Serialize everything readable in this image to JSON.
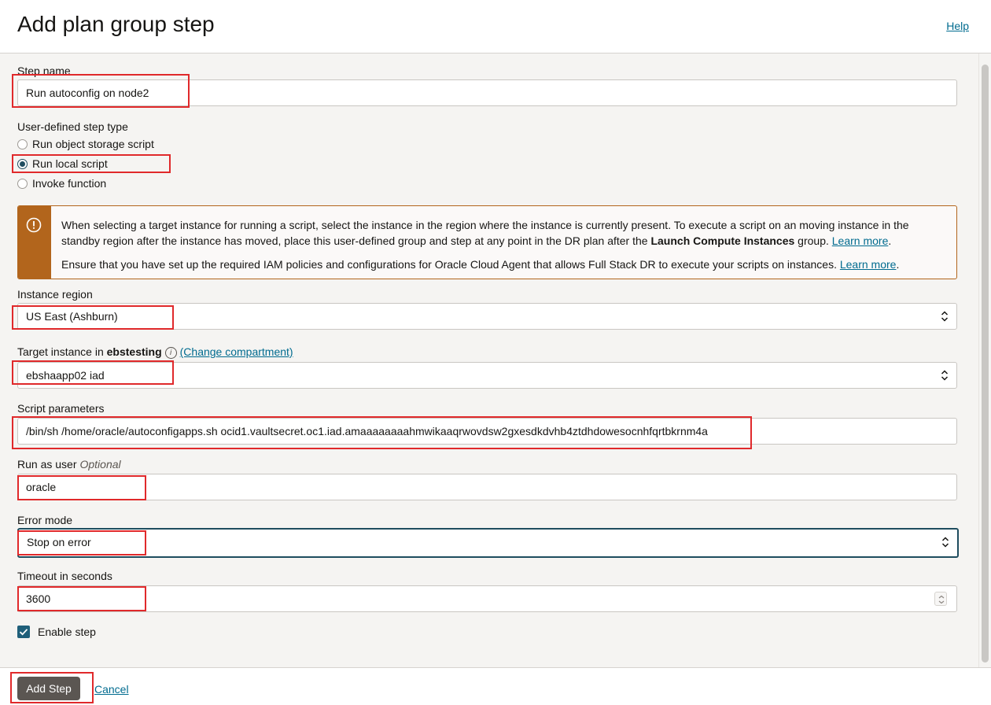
{
  "header": {
    "title": "Add plan group step",
    "help": "Help"
  },
  "form": {
    "step_name": {
      "label": "Step name",
      "value": "Run autoconfig on node2"
    },
    "step_type": {
      "label": "User-defined step type",
      "options": [
        "Run object storage script",
        "Run local script",
        "Invoke function"
      ],
      "selected": "Run local script"
    },
    "notice": {
      "line1_a": "When selecting a target instance for running a script, select the instance in the region where the instance is currently present. To execute a script on an moving instance in the standby region after the instance has moved, place this user-defined group and step at any point in the DR plan after the ",
      "line1_bold": "Launch Compute Instances",
      "line1_b": " group. ",
      "learn_more_1": "Learn more",
      "line2": "Ensure that you have set up the required IAM policies and configurations for Oracle Cloud Agent that allows Full Stack DR to execute your scripts on instances. ",
      "learn_more_2": "Learn more",
      "period": "."
    },
    "instance_region": {
      "label": "Instance region",
      "value": "US East (Ashburn)"
    },
    "target_instance": {
      "label_prefix": "Target instance in ",
      "compartment": "ebstesting",
      "change_link": "(Change compartment)",
      "value": "ebshaapp02 iad"
    },
    "script_parameters": {
      "label": "Script parameters",
      "value": "/bin/sh /home/oracle/autoconfigapps.sh ocid1.vaultsecret.oc1.iad.amaaaaaaaahmwikaaqrwovdsw2gxesdkdvhb4ztdhdowesocnhfqrtbkrnm4a"
    },
    "run_as_user": {
      "label": "Run as user",
      "optional": "Optional",
      "value": "oracle"
    },
    "error_mode": {
      "label": "Error mode",
      "value": "Stop on error"
    },
    "timeout": {
      "label": "Timeout in seconds",
      "value": "3600"
    },
    "enable_step": {
      "label": "Enable step",
      "checked": true
    }
  },
  "footer": {
    "add_step": "Add Step",
    "cancel": "Cancel"
  },
  "colors": {
    "accent": "#1f4d5f",
    "warning": "#b2651c",
    "highlight": "#e0292b",
    "link": "#006b8f"
  }
}
